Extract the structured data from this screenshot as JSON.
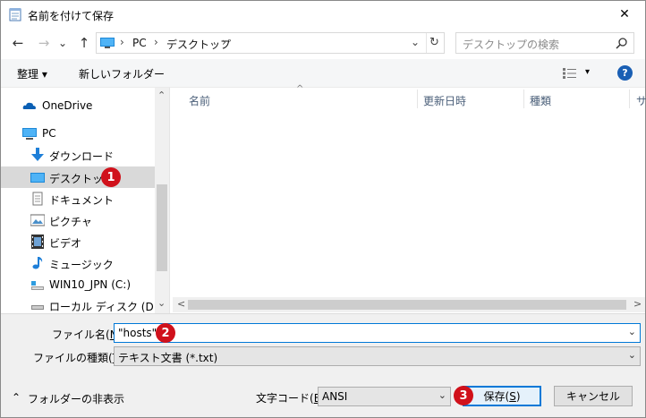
{
  "window": {
    "title": "名前を付けて保存",
    "close_glyph": "✕"
  },
  "nav": {
    "back_glyph": "←",
    "forward_glyph": "→",
    "recent_glyph": "⌄",
    "up_glyph": "↑",
    "breadcrumb": [
      "PC",
      "デスクトップ"
    ],
    "chevron": "›",
    "dropdown_glyph": "⌄",
    "refresh_glyph": "↻",
    "search_placeholder": "デスクトップの検索"
  },
  "toolbar": {
    "organize_label": "整理 ▾",
    "new_folder_label": "新しいフォルダー",
    "view_label": "▾",
    "help_label": "?"
  },
  "sidebar": {
    "items": [
      {
        "label": "OneDrive",
        "icon": "cloud-icon"
      },
      {
        "label": "PC",
        "icon": "computer-icon"
      },
      {
        "label": "ダウンロード",
        "icon": "download-arrow-icon"
      },
      {
        "label": "デスクトップ",
        "icon": "desktop-icon",
        "selected": true,
        "badge": "1"
      },
      {
        "label": "ドキュメント",
        "icon": "document-icon"
      },
      {
        "label": "ピクチャ",
        "icon": "picture-icon"
      },
      {
        "label": "ビデオ",
        "icon": "video-icon"
      },
      {
        "label": "ミュージック",
        "icon": "music-note-icon"
      },
      {
        "label": "WIN10_JPN (C:)",
        "icon": "drive-icon"
      },
      {
        "label": "ローカル ディスク (D:)",
        "icon": "drive-icon"
      }
    ],
    "scroll_up": "⌃",
    "scroll_down": "⌄"
  },
  "filelist": {
    "columns": [
      "名前",
      "更新日時",
      "種類",
      "サ"
    ],
    "sort_glyph": "^",
    "scroll_left": "<",
    "scroll_right": ">"
  },
  "bottom": {
    "filename_label_pre": "ファイル名(",
    "filename_label_key": "N",
    "filename_label_post": "):",
    "filename_value": "\"hosts\"",
    "filename_badge": "2",
    "filetype_label_pre": "ファイルの種類(",
    "filetype_label_key": "T",
    "filetype_label_post": "):",
    "filetype_value": "テキスト文書 (*.txt)",
    "hide_folders_label": "フォルダーの非表示",
    "hide_folders_glyph": "⌃",
    "encoding_label_pre": "文字コード(",
    "encoding_label_key": "E",
    "encoding_label_post": "):",
    "encoding_value": "ANSI",
    "save_label_pre": "保存(",
    "save_label_key": "S",
    "save_label_post": ")",
    "save_badge": "3",
    "cancel_label": "キャンセル",
    "arrow_glyph": "⌄"
  },
  "colors": {
    "accent": "#0078d7",
    "badge": "#d0111b",
    "selection": "#d9d9d9"
  }
}
